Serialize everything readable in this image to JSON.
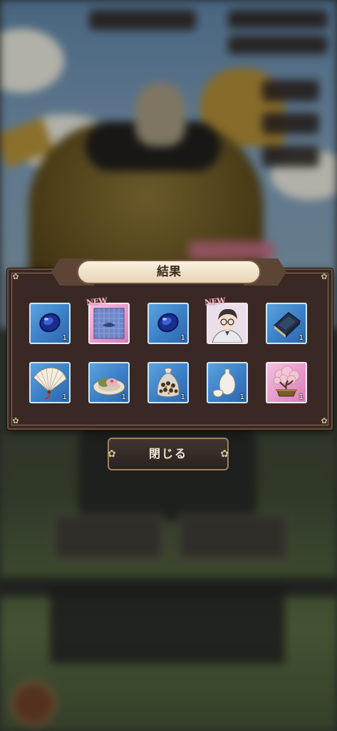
{
  "dialog": {
    "title": "結果",
    "items": [
      {
        "kind": "blue-gem",
        "icon": "sapphire-icon",
        "quantity": "1",
        "new": false,
        "frame": "blue"
      },
      {
        "kind": "pattern",
        "icon": "blue-pattern-icon",
        "quantity": "",
        "new": true,
        "frame": "pink"
      },
      {
        "kind": "blue-gem",
        "icon": "sapphire-icon",
        "quantity": "1",
        "new": false,
        "frame": "blue"
      },
      {
        "kind": "character",
        "icon": "character-portrait-icon",
        "quantity": "",
        "new": true,
        "frame": "pink"
      },
      {
        "kind": "book",
        "icon": "book-icon",
        "quantity": "1",
        "new": false,
        "frame": "blue"
      },
      {
        "kind": "fan",
        "icon": "folding-fan-icon",
        "quantity": "1",
        "new": false,
        "frame": "blue"
      },
      {
        "kind": "sweets",
        "icon": "sweets-plate-icon",
        "quantity": "1",
        "new": false,
        "frame": "blue"
      },
      {
        "kind": "snack-bag",
        "icon": "snack-bag-icon",
        "quantity": "1",
        "new": false,
        "frame": "blue"
      },
      {
        "kind": "sake",
        "icon": "sake-set-icon",
        "quantity": "1",
        "new": false,
        "frame": "blue"
      },
      {
        "kind": "bonsai",
        "icon": "bonsai-icon",
        "quantity": "1",
        "new": false,
        "frame": "pink"
      }
    ],
    "new_label": "NEW"
  },
  "close_button": {
    "label": "閉じる"
  },
  "colors": {
    "dialog_bg": "#3a2824",
    "item_blue": "#3b7fc6",
    "item_pink": "#e597c8",
    "title_bg": "#fbf1df"
  }
}
